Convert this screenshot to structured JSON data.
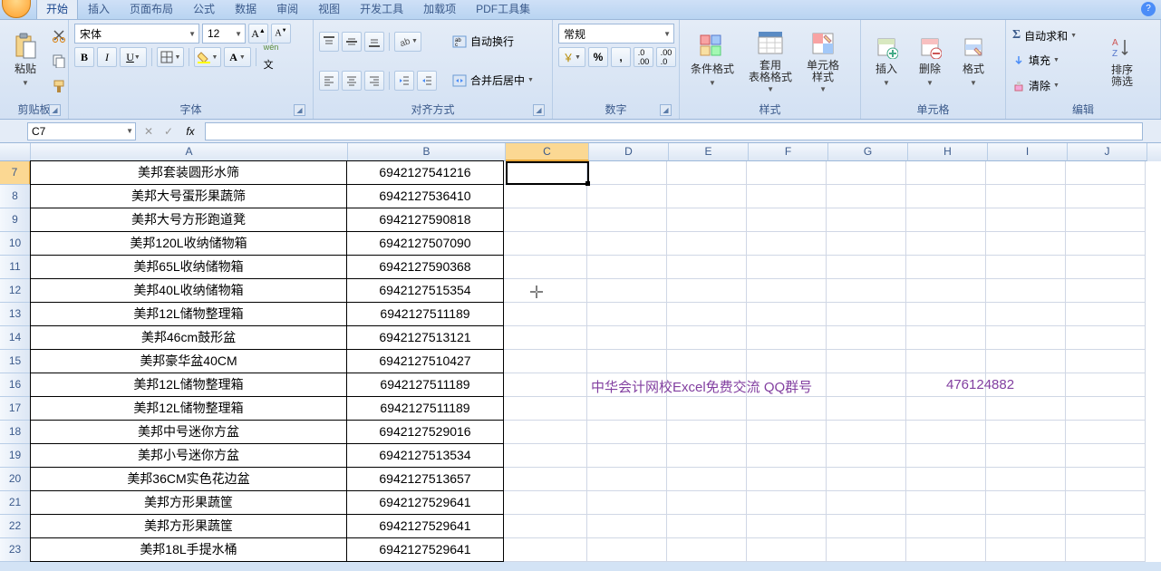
{
  "tabs": [
    "开始",
    "插入",
    "页面布局",
    "公式",
    "数据",
    "审阅",
    "视图",
    "开发工具",
    "加载项",
    "PDF工具集"
  ],
  "activeTab": 0,
  "ribbon": {
    "clipboard": {
      "label": "剪贴板",
      "paste": "粘贴"
    },
    "font": {
      "label": "字体",
      "family": "宋体",
      "size": "12",
      "bold": "B",
      "italic": "I",
      "underline": "U"
    },
    "alignment": {
      "label": "对齐方式",
      "wrap": "自动换行",
      "merge": "合并后居中"
    },
    "number": {
      "label": "数字",
      "format": "常规"
    },
    "styles": {
      "label": "样式",
      "cond": "条件格式",
      "table": "套用\n表格格式",
      "cell": "单元格\n样式"
    },
    "cells": {
      "label": "单元格",
      "insert": "插入",
      "delete": "删除",
      "format": "格式"
    },
    "editing": {
      "label": "编辑",
      "autosum": "自动求和",
      "fill": "填充",
      "clear": "清除",
      "sortfilter": "排序\n筛选"
    }
  },
  "nameBox": "C7",
  "fxLabel": "fx",
  "columns": [
    "A",
    "B",
    "C",
    "D",
    "E",
    "F",
    "G",
    "H",
    "I",
    "J"
  ],
  "rowsStart": 7,
  "grid": [
    {
      "A": "美邦套装圆形水筛",
      "B": "6942127541216"
    },
    {
      "A": "美邦大号蛋形果蔬筛",
      "B": "6942127536410"
    },
    {
      "A": "美邦大号方形跑道凳",
      "B": "6942127590818"
    },
    {
      "A": "美邦120L收纳储物箱",
      "B": "6942127507090"
    },
    {
      "A": "美邦65L收纳储物箱",
      "B": "6942127590368"
    },
    {
      "A": "美邦40L收纳储物箱",
      "B": "6942127515354"
    },
    {
      "A": "美邦12L储物整理箱",
      "B": "6942127511189"
    },
    {
      "A": "美邦46cm鼓形盆",
      "B": "6942127513121"
    },
    {
      "A": "美邦豪华盆40CM",
      "B": "6942127510427"
    },
    {
      "A": "美邦12L储物整理箱",
      "B": "6942127511189"
    },
    {
      "A": "美邦12L储物整理箱",
      "B": "6942127511189"
    },
    {
      "A": "美邦中号迷你方盆",
      "B": "6942127529016"
    },
    {
      "A": "美邦小号迷你方盆",
      "B": "6942127513534"
    },
    {
      "A": "美邦36CM实色花边盆",
      "B": "6942127513657"
    },
    {
      "A": "美邦方形果蔬筐",
      "B": "6942127529641"
    },
    {
      "A": "美邦方形果蔬筐",
      "B": "6942127529641"
    },
    {
      "A": "美邦18L手提水桶",
      "B": "6942127529641"
    }
  ],
  "overlay1": "中华会计网校Excel免费交流  QQ群号",
  "overlay2": "476124882",
  "activeCell": {
    "col": "C",
    "row": 7
  }
}
